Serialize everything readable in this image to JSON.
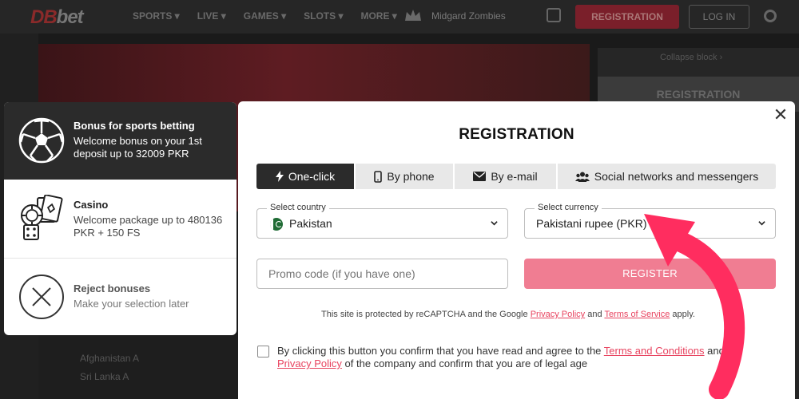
{
  "site": {
    "logo_main": "DB",
    "logo_sub": "bet",
    "nav": [
      "SPORTS ▾",
      "LIVE ▾",
      "GAMES ▾",
      "SLOTS ▾",
      "MORE ▾"
    ],
    "promo_name": "Midgard Zombies",
    "registration_btn": "REGISTRATION",
    "login_btn": "LOG IN",
    "collapse_block": "Collapse block ›",
    "right_tab": "REGISTRATION",
    "matches": [
      "Afghanistan A",
      "Sri Lanka A"
    ]
  },
  "bonuses": [
    {
      "icon": "soccer-ball-icon",
      "title": "Bonus for sports betting",
      "desc": "Welcome bonus on your 1st deposit up to 32009 PKR",
      "active": true
    },
    {
      "icon": "casino-chips-cards-dice-icon",
      "title": "Casino",
      "desc": "Welcome package up to 480136 PKR + 150 FS",
      "active": false
    },
    {
      "icon": "reject-x-circle-icon",
      "title": "Reject bonuses",
      "desc": "Make your selection later",
      "active": false
    }
  ],
  "modal": {
    "title": "REGISTRATION",
    "close": "✕",
    "tabs": [
      {
        "label": "One-click",
        "icon": "lightning-icon",
        "selected": true
      },
      {
        "label": "By phone",
        "icon": "phone-icon",
        "selected": false
      },
      {
        "label": "By e-mail",
        "icon": "envelope-icon",
        "selected": false
      },
      {
        "label": "Social networks and messengers",
        "icon": "users-icon",
        "selected": false
      }
    ],
    "country": {
      "label": "Select country",
      "value": "Pakistan",
      "flag_icon": "pakistan-flag-icon"
    },
    "currency": {
      "label": "Select currency",
      "value": "Pakistani rupee (PKR)"
    },
    "promo": {
      "placeholder": "Promo code (if you have one)"
    },
    "register_btn": "REGISTER",
    "recaptcha": {
      "prefix": "This site is protected by reCAPTCHA and the Google ",
      "privacy": "Privacy Policy",
      "and": " and ",
      "terms": "Terms of Service",
      "suffix": " apply."
    },
    "agree": {
      "prefix": "By clicking this button you confirm that you have read and agree to the ",
      "terms": "Terms and Conditions",
      "and": " and ",
      "privacy": "Privacy Policy",
      "suffix": " of the company and confirm that you are of legal age"
    }
  },
  "colors": {
    "accent": "#e8435f",
    "register_btn": "#f07d92",
    "active_tab": "#2b2b2b",
    "arrow": "#ff2d5f"
  }
}
